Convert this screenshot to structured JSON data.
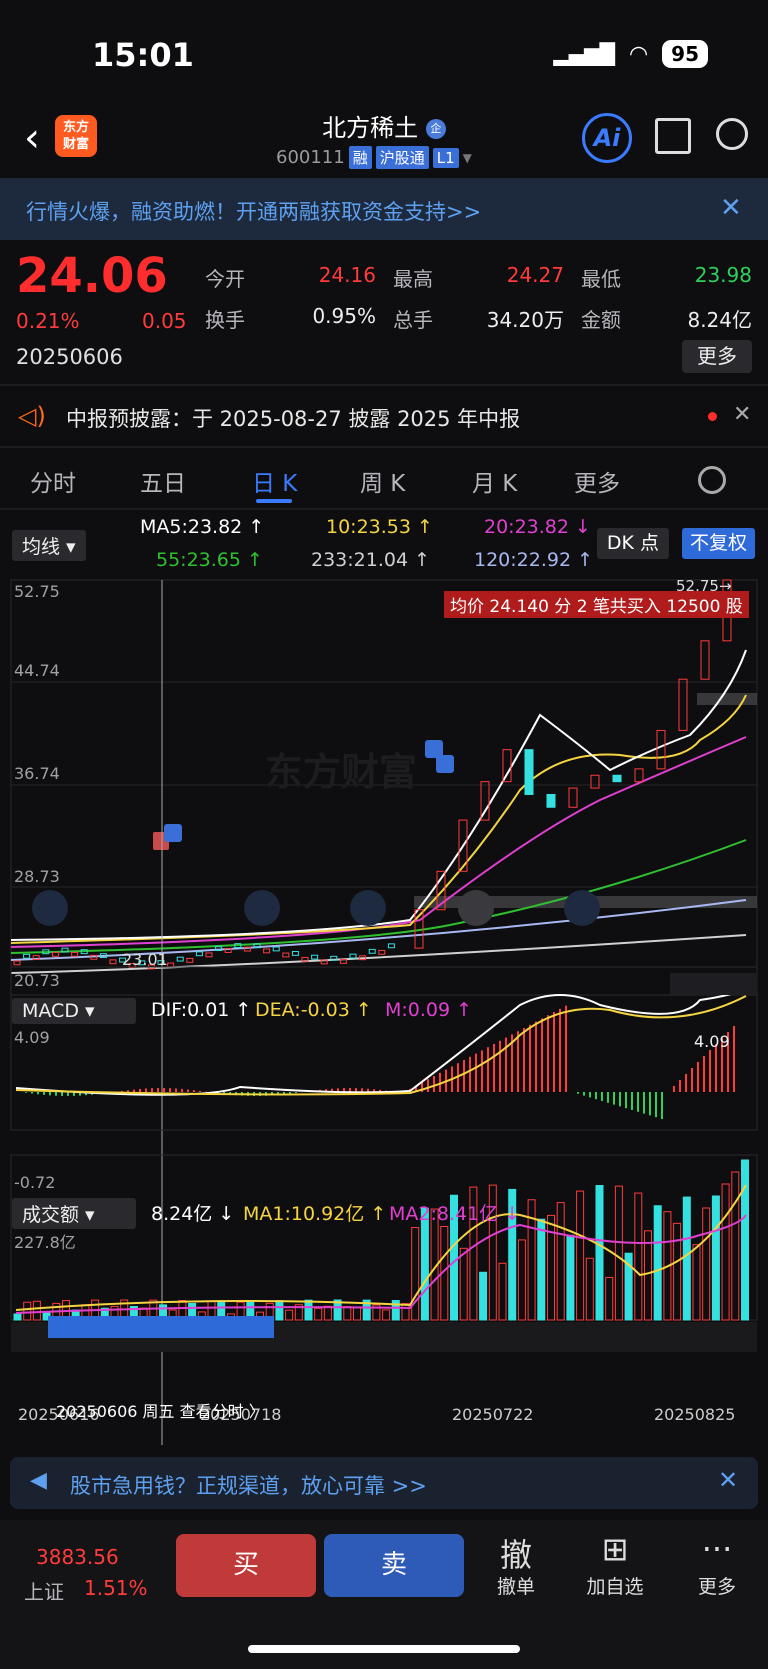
{
  "status": {
    "time": "15:01",
    "battery": "95"
  },
  "header": {
    "name": "北方稀土",
    "name_badge": "企",
    "logo": "东方\n财富",
    "code": "600111",
    "tags": [
      "融",
      "沪股通",
      "L1"
    ],
    "ai": "Ai"
  },
  "banner": {
    "text": "行情火爆，融资助燃！开通两融获取资金支持>>",
    "close": "✕"
  },
  "quote": {
    "price": "24.06",
    "pct": "0.21%",
    "change": "0.05",
    "date": "20250606",
    "fields": [
      {
        "label": "今开",
        "value": "24.16",
        "color": "#ff3b3b"
      },
      {
        "label": "最高",
        "value": "24.27",
        "color": "#ff3b3b"
      },
      {
        "label": "最低",
        "value": "23.98",
        "color": "#2fd05a"
      },
      {
        "label": "换手",
        "value": "0.95%",
        "color": "#eeeeee"
      },
      {
        "label": "总手",
        "value": "34.20万",
        "color": "#eeeeee"
      },
      {
        "label": "金额",
        "value": "8.24亿",
        "color": "#eeeeee"
      }
    ],
    "more": "更多"
  },
  "announcement": {
    "text": "中报预披露：于 2025-08-27 披露 2025 年中报",
    "close": "✕"
  },
  "tabs": [
    "分时",
    "五日",
    "日 K",
    "周 K",
    "月 K",
    "更多"
  ],
  "ma_row": {
    "dropdown": "均线",
    "ma5": "MA5:23.82 ↑",
    "ma10": "10:23.53 ↑",
    "ma20": "20:23.82 ↓",
    "ma55": "55:23.65 ↑",
    "ma233": "233:21.04 ↑",
    "ma120": "120:22.92 ↑",
    "dk": "DK 点",
    "fq": "不复权",
    "colors": {
      "ma5": "#ffffff",
      "ma10": "#f5d442",
      "ma20": "#e040d0",
      "ma55": "#2fc02f",
      "ma233": "#d0d0d0",
      "ma120": "#a8b8f0"
    }
  },
  "kline": {
    "y_labels": [
      "52.75",
      "44.74",
      "36.74",
      "28.73",
      "20.73"
    ],
    "low_mark": "23.01",
    "high_tag": "52.75→",
    "trade_tip": "均价 24.140 分 2 笔共买入 12500 股",
    "watermark": "东方财富"
  },
  "macd": {
    "dropdown": "MACD",
    "dif": "DIF:0.01 ↑",
    "dea": "DEA:-0.03 ↑",
    "m": "M:0.09 ↑",
    "y_top": "4.09",
    "y_bottom": "-0.72",
    "tag": "4.09"
  },
  "volume": {
    "dropdown": "成交额",
    "val": "8.24亿 ↓",
    "ma1": "MA1:10.92亿 ↑",
    "ma2": "MA2:8.41亿 ↓",
    "y_top": "227.8亿",
    "dates": [
      "20250616",
      "20250718",
      "20250722",
      "20250825"
    ],
    "cursor_label": "20250606 周五 查看分时 〉"
  },
  "promo": {
    "text": "股市急用钱？正规渠道，放心可靠 >>",
    "close": "✕"
  },
  "bottom": {
    "index_value": "3883.56",
    "index_name": "上证",
    "index_pct": "1.51%",
    "buy": "买",
    "sell": "卖",
    "items": [
      {
        "icon": "撤",
        "label": "撤单"
      },
      {
        "icon": "⊞",
        "label": "加自选"
      },
      {
        "icon": "···",
        "label": "更多"
      }
    ]
  },
  "chart_data": {
    "type": "bar",
    "title": "",
    "candles_close_approx": [
      23.0,
      23.1,
      23.3,
      23.5,
      23.4,
      23.6,
      23.8,
      24.0,
      24.1,
      24.06,
      27.0,
      30.0,
      34.0,
      37.0,
      39.5,
      36.0,
      35.0,
      36.5,
      37.5,
      37.0,
      38.0,
      41.0,
      45.0,
      48.0,
      52.75
    ],
    "ylim": [
      20.73,
      52.75
    ]
  }
}
